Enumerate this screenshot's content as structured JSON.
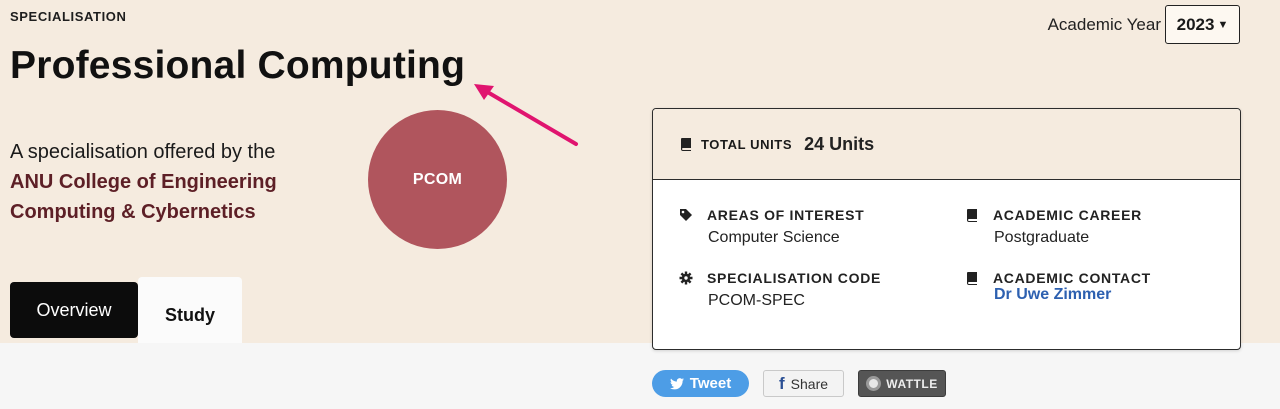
{
  "header": {
    "eyebrow": "SPECIALISATION",
    "title": "Professional Computing",
    "offered_prefix": "A specialisation offered by the",
    "college_line1": "ANU College of Engineering",
    "college_line2": "Computing & Cybernetics",
    "badge": "PCOM"
  },
  "academic_year": {
    "label": "Academic Year",
    "selected": "2023"
  },
  "tabs": [
    {
      "label": "Overview",
      "active": false
    },
    {
      "label": "Study",
      "active": true
    }
  ],
  "card": {
    "total_units_label": "TOTAL UNITS",
    "total_units_value": "24 Units",
    "fields": [
      {
        "label": "AREAS OF INTEREST",
        "value": "Computer Science",
        "icon": "tag-icon"
      },
      {
        "label": "ACADEMIC CAREER",
        "value": "Postgraduate",
        "icon": "book-icon"
      },
      {
        "label": "SPECIALISATION CODE",
        "value": "PCOM-SPEC",
        "icon": "gear-icon"
      },
      {
        "label": "ACADEMIC CONTACT",
        "value": "Dr Uwe Zimmer",
        "icon": "book-icon"
      }
    ]
  },
  "share": {
    "tweet": "Tweet",
    "facebook": "Share",
    "wattle": "WATTLE"
  },
  "colors": {
    "hero_bg": "#f5ebdf",
    "college": "#5d1f26",
    "badge": "#b0555d",
    "link": "#2d60b0",
    "annotation_arrow": "#e0146f"
  }
}
